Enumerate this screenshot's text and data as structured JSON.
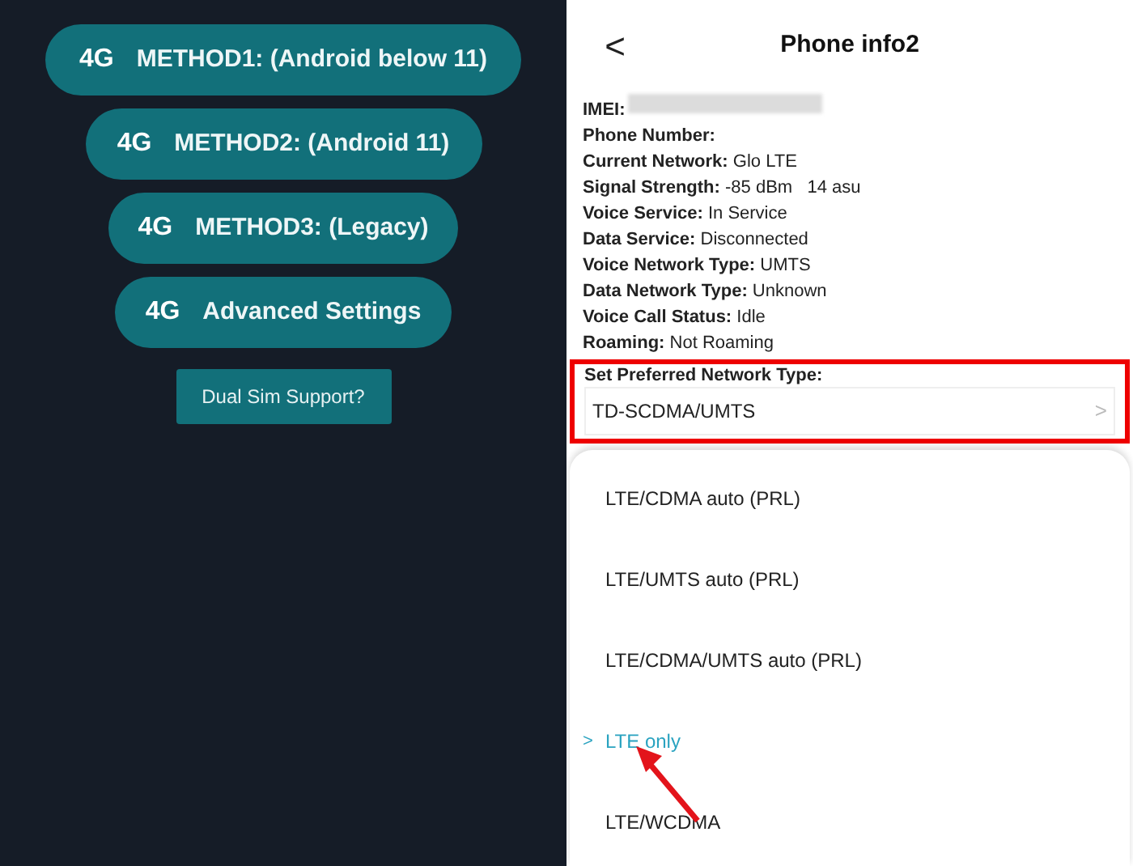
{
  "app_screen": {
    "method_buttons": [
      {
        "badge": "4G",
        "label": "METHOD1: (Android below 11)"
      },
      {
        "badge": "4G",
        "label": "METHOD2: (Android 11)"
      },
      {
        "badge": "4G",
        "label": "METHOD3: (Legacy)"
      },
      {
        "badge": "4G",
        "label": "Advanced Settings"
      }
    ],
    "dual_sim_button": "Dual Sim Support?"
  },
  "phone_info": {
    "back": "<",
    "title": "Phone info2",
    "info": [
      {
        "label": "IMEI:",
        "redacted": true
      },
      {
        "label": "Phone Number:"
      },
      {
        "label": "Current Network:",
        "value": "Glo LTE"
      },
      {
        "label": "Signal Strength:",
        "value": "-85 dBm   14 asu"
      },
      {
        "label": "Voice Service:",
        "value": "In Service"
      },
      {
        "label": "Data Service:",
        "value": "Disconnected"
      },
      {
        "label": "Voice Network Type:",
        "value": "UMTS"
      },
      {
        "label": "Data Network Type:",
        "value": "Unknown"
      },
      {
        "label": "Voice Call Status:",
        "value": "Idle"
      },
      {
        "label": "Roaming:",
        "value": "Not Roaming"
      }
    ],
    "preferred_network": {
      "label": "Set Preferred Network Type:",
      "value": "TD-SCDMA/UMTS",
      "chevron": ">"
    },
    "options": [
      {
        "label": "LTE/CDMA auto (PRL)",
        "selected": false
      },
      {
        "label": "LTE/UMTS auto (PRL)",
        "selected": false
      },
      {
        "label": "LTE/CDMA/UMTS auto (PRL)",
        "selected": false
      },
      {
        "label": "LTE only",
        "selected": true,
        "marker": ">"
      },
      {
        "label": "LTE/WCDMA",
        "selected": false
      }
    ]
  }
}
